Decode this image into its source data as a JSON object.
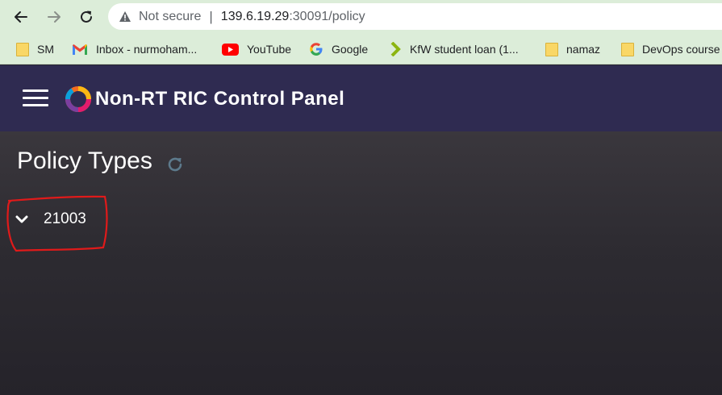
{
  "browser": {
    "security_label": "Not secure",
    "separator": "|",
    "url_host": "139.6.19.29",
    "url_path": ":30091/policy"
  },
  "bookmarks": [
    {
      "label": "SM",
      "icon": "folder-icon"
    },
    {
      "label": "Inbox - nurmoham...",
      "icon": "gmail-icon"
    },
    {
      "label": "YouTube",
      "icon": "youtube-icon"
    },
    {
      "label": "Google",
      "icon": "google-icon"
    },
    {
      "label": "KfW student loan (1...",
      "icon": "kfw-icon"
    },
    {
      "label": "namaz",
      "icon": "folder-icon"
    },
    {
      "label": "DevOps course",
      "icon": "folder-icon"
    }
  ],
  "app": {
    "title": "Non-RT RIC Control Panel"
  },
  "page": {
    "title": "Policy Types",
    "policy_types": [
      {
        "id": "21003"
      }
    ]
  },
  "colors": {
    "header": "#2f2b51",
    "browser_chrome": "#dcedd9",
    "annotation": "#e01a1a"
  }
}
